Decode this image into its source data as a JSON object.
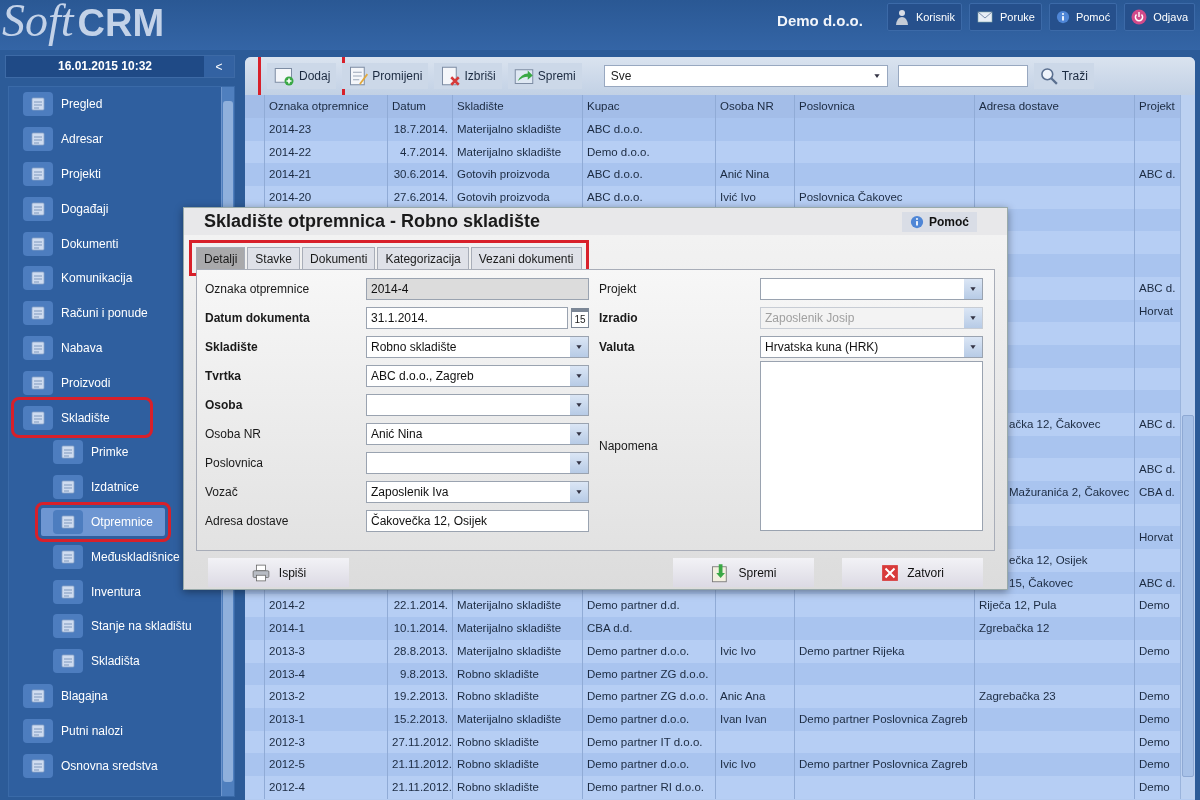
{
  "header": {
    "logo_script": "Soft",
    "logo_bold": "CRM",
    "company": "Demo d.o.o.",
    "buttons": [
      {
        "label": "Korisnik",
        "kind": "user"
      },
      {
        "label": "Poruke",
        "kind": "mail"
      },
      {
        "label": "Pomoć",
        "kind": "info"
      },
      {
        "label": "Odjava",
        "kind": "power"
      }
    ]
  },
  "sidebar": {
    "datetime": "16.01.2015 10:32",
    "collapse": "<",
    "items": [
      {
        "label": "Pregled",
        "selected": false,
        "highlighted": false
      },
      {
        "label": "Adresar",
        "selected": false,
        "highlighted": false
      },
      {
        "label": "Projekti",
        "selected": false,
        "highlighted": false
      },
      {
        "label": "Događaji",
        "selected": false,
        "highlighted": false
      },
      {
        "label": "Dokumenti",
        "selected": false,
        "highlighted": false
      },
      {
        "label": "Komunikacija",
        "selected": false,
        "highlighted": false
      },
      {
        "label": "Računi i ponude",
        "selected": false,
        "highlighted": false
      },
      {
        "label": "Nabava",
        "selected": false,
        "highlighted": false
      },
      {
        "label": "Proizvodi",
        "selected": false,
        "highlighted": false
      },
      {
        "label": "Skladište",
        "selected": false,
        "highlighted": true,
        "children": [
          {
            "label": "Primke",
            "selected": false,
            "highlighted": false
          },
          {
            "label": "Izdatnice",
            "selected": false,
            "highlighted": false
          },
          {
            "label": "Otpremnice",
            "selected": true,
            "highlighted": true
          },
          {
            "label": "Međuskladišnice",
            "selected": false,
            "highlighted": false
          },
          {
            "label": "Inventura",
            "selected": false,
            "highlighted": false
          },
          {
            "label": "Stanje na skladištu",
            "selected": false,
            "highlighted": false
          },
          {
            "label": "Skladišta",
            "selected": false,
            "highlighted": false
          }
        ]
      },
      {
        "label": "Blagajna",
        "selected": false,
        "highlighted": false
      },
      {
        "label": "Putni nalozi",
        "selected": false,
        "highlighted": false
      },
      {
        "label": "Osnovna sredstva",
        "selected": false,
        "highlighted": false
      }
    ]
  },
  "toolbar": {
    "buttons": [
      {
        "label": "Dodaj",
        "kind": "add",
        "highlighted": true
      },
      {
        "label": "Promijeni",
        "kind": "edit",
        "highlighted": false
      },
      {
        "label": "Izbriši",
        "kind": "delete",
        "highlighted": false
      },
      {
        "label": "Spremi",
        "kind": "save",
        "highlighted": false
      }
    ],
    "filter": {
      "value": "Sve"
    },
    "search_button": "Traži"
  },
  "table": {
    "columns": [
      "Oznaka otpremnice",
      "Datum",
      "Skladište",
      "Kupac",
      "Osoba NR",
      "Poslovnica",
      "Adresa dostave",
      "Projekt"
    ],
    "rows": [
      {
        "kind": "full",
        "cells": [
          "2014-23",
          "18.7.2014.",
          "Materijalno skladište",
          "ABC d.o.o.",
          null,
          null,
          null,
          null
        ]
      },
      {
        "kind": "full",
        "cells": [
          "2014-22",
          "4.7.2014.",
          "Materijalno skladište",
          "Demo d.o.o.",
          null,
          null,
          null,
          null
        ]
      },
      {
        "kind": "full",
        "cells": [
          "2014-21",
          "30.6.2014.",
          "Gotovih proizvoda",
          "ABC d.o.o.",
          "Anić Nina",
          null,
          null,
          "ABC d."
        ]
      },
      {
        "kind": "full",
        "cells": [
          "2014-20",
          "27.6.2014.",
          "Gotovih proizvoda",
          "ABC d.o.o.",
          "Ivić Ivo",
          "Poslovnica Čakovec",
          null,
          null
        ]
      },
      {
        "kind": "covered"
      },
      {
        "kind": "covered"
      },
      {
        "kind": "covered"
      },
      {
        "kind": "covered",
        "projekt": "ABC d."
      },
      {
        "kind": "covered",
        "projekt": "Horvat"
      },
      {
        "kind": "covered"
      },
      {
        "kind": "covered"
      },
      {
        "kind": "covered"
      },
      {
        "kind": "covered"
      },
      {
        "kind": "covered",
        "adresa_dostave": "ačka 12, Čakovec",
        "projekt": "ABC d."
      },
      {
        "kind": "covered"
      },
      {
        "kind": "covered",
        "projekt": "ABC d."
      },
      {
        "kind": "covered",
        "adresa_dostave": "Mažuranića 2, Čakovec",
        "projekt": "CBA d."
      },
      {
        "kind": "covered"
      },
      {
        "kind": "covered",
        "projekt": "Horvat"
      },
      {
        "kind": "covered",
        "adresa_dostave": "ečka 12, Osijek"
      },
      {
        "kind": "covered",
        "adresa_dostave": "15, Čakovec",
        "projekt": "ABC d."
      },
      {
        "kind": "full",
        "cells": [
          "2014-2",
          "22.1.2014.",
          "Materijalno skladište",
          "Demo partner d.d.",
          null,
          null,
          "Riječa 12, Pula",
          "Demo"
        ]
      },
      {
        "kind": "full",
        "cells": [
          "2014-1",
          "10.1.2014.",
          "Materijalno skladište",
          "CBA d.d.",
          null,
          null,
          "Zgrebačka 12",
          null
        ]
      },
      {
        "kind": "full",
        "cells": [
          "2013-3",
          "28.8.2013.",
          "Materijalno skladište",
          "Demo partner d.o.o.",
          "Ivic Ivo",
          "Demo partner Rijeka",
          null,
          "Demo"
        ]
      },
      {
        "kind": "full",
        "cells": [
          "2013-4",
          "9.8.2013.",
          "Robno skladište",
          "Demo partner ZG d.o.o.",
          null,
          null,
          null,
          null
        ]
      },
      {
        "kind": "full",
        "cells": [
          "2013-2",
          "19.2.2013.",
          "Robno skladište",
          "Demo partner ZG d.o.o.",
          "Anic Ana",
          null,
          "Zagrebačka 23",
          "Demo"
        ]
      },
      {
        "kind": "full",
        "cells": [
          "2013-1",
          "15.2.2013.",
          "Materijalno skladište",
          "Demo partner d.o.o.",
          "Ivan Ivan",
          "Demo partner Poslovnica Zagreb",
          null,
          "Demo"
        ]
      },
      {
        "kind": "full",
        "cells": [
          "2012-3",
          "27.11.2012.",
          "Robno skladište",
          "Demo partner IT d.o.o.",
          null,
          null,
          null,
          "Demo"
        ]
      },
      {
        "kind": "full",
        "cells": [
          "2012-5",
          "21.11.2012.",
          "Robno skladište",
          "Demo partner d.o.o.",
          "Ivic Ivo",
          "Demo partner Poslovnica Zagreb",
          null,
          "Demo"
        ]
      },
      {
        "kind": "full",
        "cells": [
          "2012-4",
          "21.11.2012.",
          "Robno skladište",
          "Demo partner RI d.o.o.",
          null,
          null,
          null,
          "Demo"
        ]
      }
    ]
  },
  "dialog": {
    "title": "Skladište otpremnica - Robno skladište",
    "help": "Pomoć",
    "tabs_highlighted": true,
    "tabs": [
      {
        "label": "Detalji",
        "selected": true
      },
      {
        "label": "Stavke",
        "selected": false
      },
      {
        "label": "Dokumenti",
        "selected": false
      },
      {
        "label": "Kategorizacija",
        "selected": false
      },
      {
        "label": "Vezani dokumenti",
        "selected": false
      }
    ],
    "left_fields": [
      {
        "label": "Oznaka otpremnice",
        "required": false,
        "kind": "readonly",
        "value": "2014-4",
        "disabled": false
      },
      {
        "label": "Datum dokumenta",
        "required": true,
        "kind": "date",
        "value": "31.1.2014.",
        "calendar_day": "15",
        "disabled": false
      },
      {
        "label": "Skladište",
        "required": true,
        "kind": "select",
        "value": "Robno skladište",
        "disabled": false
      },
      {
        "label": "Tvrtka",
        "required": true,
        "kind": "select",
        "value": "ABC d.o.o., Zagreb",
        "disabled": false
      },
      {
        "label": "Osoba",
        "required": true,
        "kind": "select",
        "disabled": false
      },
      {
        "label": "Osoba NR",
        "required": false,
        "kind": "select",
        "value": "Anić Nina",
        "disabled": false
      },
      {
        "label": "Poslovnica",
        "required": false,
        "kind": "select",
        "disabled": false
      },
      {
        "label": "Vozač",
        "required": false,
        "kind": "select",
        "value": "Zaposlenik Iva",
        "disabled": false
      },
      {
        "label": "Adresa dostave",
        "required": false,
        "kind": "text",
        "value": "Čakovečka 12, Osijek",
        "disabled": false
      }
    ],
    "right_fields": [
      {
        "label": "Projekt",
        "required": false,
        "kind": "select",
        "disabled": false
      },
      {
        "label": "Izradio",
        "required": true,
        "kind": "select",
        "value": "Zaposlenik Josip",
        "disabled": true
      },
      {
        "label": "Valuta",
        "required": true,
        "kind": "select",
        "value": "Hrvatska kuna (HRK)",
        "disabled": false
      },
      {
        "label": "Napomena",
        "required": false,
        "kind": "textarea",
        "disabled": false
      }
    ],
    "buttons": [
      {
        "label": "Ispiši",
        "kind": "print"
      },
      {
        "label": "Spremi",
        "kind": "save"
      },
      {
        "label": "Zatvori",
        "kind": "close"
      }
    ]
  }
}
